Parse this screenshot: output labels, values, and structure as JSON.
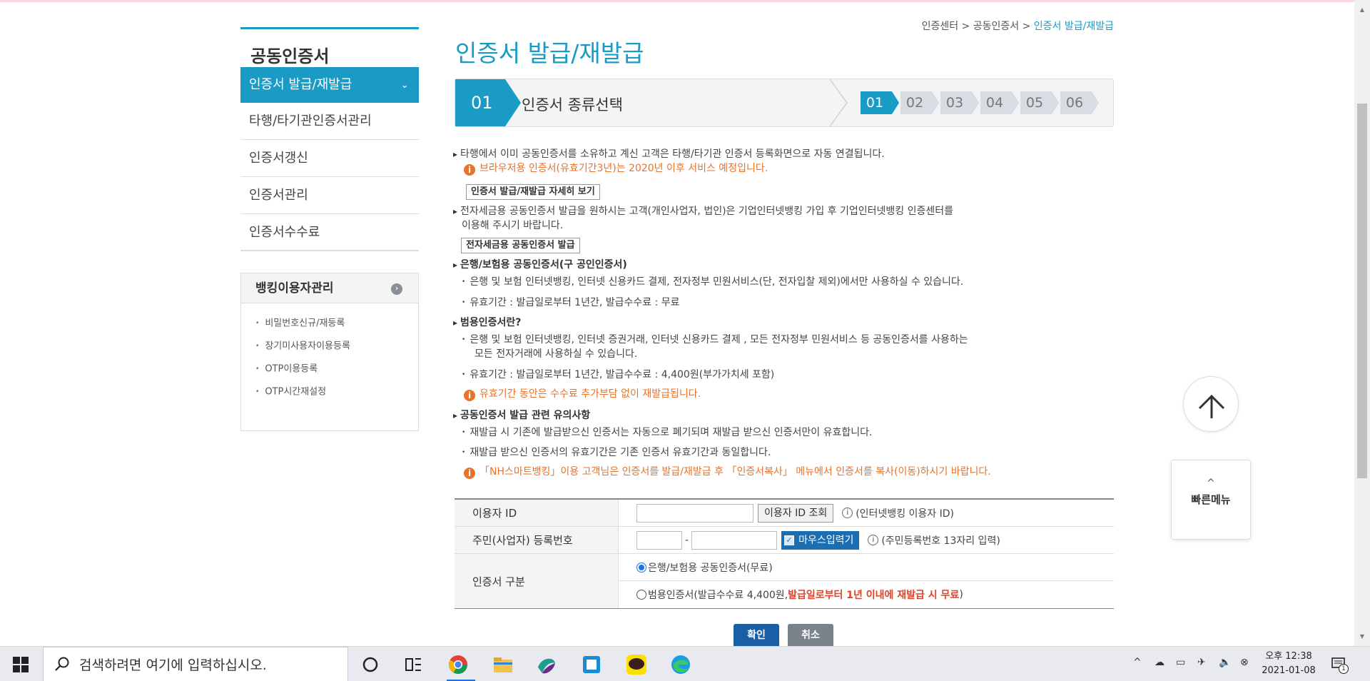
{
  "breadcrumb": {
    "home": "인증센터",
    "parent": "공동인증서",
    "current": "인증서 발급/재발급",
    "sep": ">"
  },
  "page_title": "인증서 발급/재발급",
  "sidebar": {
    "title": "공동인증서",
    "items": [
      {
        "label": "인증서 발급/재발급",
        "active": true
      },
      {
        "label": "타행/타기관인증서관리"
      },
      {
        "label": "인증서갱신"
      },
      {
        "label": "인증서관리"
      },
      {
        "label": "인증서수수료"
      }
    ],
    "box": {
      "title": "뱅킹이용자관리",
      "items": [
        "비밀번호신규/재등록",
        "장기미사용자이용등록",
        "OTP이용등록",
        "OTP시간재설정"
      ]
    }
  },
  "step": {
    "current_num": "01",
    "current_label": "인증서 종류선택",
    "steps": [
      "01",
      "02",
      "03",
      "04",
      "05",
      "06"
    ]
  },
  "content": {
    "p1": "타행에서 이미 공동인증서를 소유하고 계신 고객은 타행/타기관 인증서 등록화면으로 자동 연결됩니다.",
    "w1": "브라우저용 인증서(유효기간3년)는 2020년 이후 서비스 예정입니다.",
    "btn1": "인증서 발급/재발급 자세히 보기",
    "p2a": "전자세금용 공동인증서 발급을 원하시는 고객(개인사업자, 법인)은 기업인터넷뱅킹 가입 후 기업인터넷뱅킹 인증센터를",
    "p2b": "이용해 주시기 바랍니다.",
    "btn2": "전자세금용 공동인증서 발급",
    "h3": "은행/보험용 공동인증서(구 공인인증서)",
    "s3a": "은행 및 보험 인터넷뱅킹, 인터넷 신용카드 결제, 전자정부 민원서비스(단, 전자입찰 제외)에서만 사용하실 수 있습니다.",
    "s3b": "유효기간 : 발급일로부터 1년간, 발급수수료 : 무료",
    "h4": "범용인증서란?",
    "s4a": "은행 및 보험 인터넷뱅킹, 인터넷 증권거래, 인터넷 신용카드 결제 , 모든 전자정부 민원서비스 등 공동인증서를 사용하는",
    "s4a2": "모든 전자거래에 사용하실 수 있습니다.",
    "s4b": "유효기간 : 발급일로부터 1년간, 발급수수료 : 4,400원(부가가치세 포함)",
    "w4": "유효기간 동안은 수수료 추가부담 없이 재발급됩니다.",
    "h5": "공동인증서 발급 관련 유의사항",
    "s5a": "재발급 시 기존에 발급받으신 인증서는 자동으로 폐기되며 재발급 받으신 인증서만이 유효합니다.",
    "s5b": "재발급 받으신 인증서의 유효기간은 기존 인증서 유효기간과 동일합니다.",
    "w5": "「NH스마트뱅킹」이용 고객님은 인증서를 발급/재발급 후 「인증서복사」 메뉴에서 인증서를 복사(이동)하시기 바랍니다."
  },
  "form": {
    "id_label": "이용자 ID",
    "id_value": "",
    "id_lookup": "이용자 ID 조회",
    "id_hint": "(인터넷뱅킹 이용자 ID)",
    "rrn_label": "주민(사업자) 등록번호",
    "rrn_dash": "-",
    "mouse_input": "마우스입력기",
    "rrn_hint": "(주민등록번호 13자리 입력)",
    "type_label": "인증서 구분",
    "opt1": "은행/보험용 공동인증서(무료)",
    "opt2_pre": "범용인증서(발급수수료 4,400원, ",
    "opt2_red": "발급일로부터 1년 이내에 재발급 시 무료",
    "opt2_post": ")"
  },
  "buttons": {
    "ok": "확인",
    "cancel": "취소"
  },
  "quick_menu": "빠른메뉴",
  "taskbar": {
    "search_placeholder": "검색하려면 여기에 입력하십시오.",
    "ampm_time": "오후 12:38",
    "date": "2021-01-08",
    "notif_count": "1"
  },
  "colors": {
    "accent": "#1a9bc6",
    "warn": "#e8732a",
    "confirm": "#1a5fa6"
  }
}
